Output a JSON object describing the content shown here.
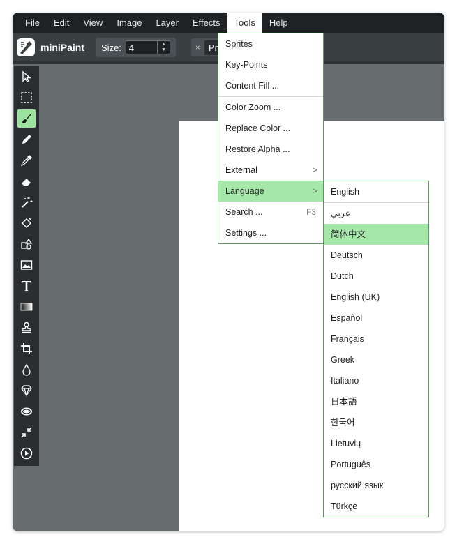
{
  "menubar": {
    "items": [
      "File",
      "Edit",
      "View",
      "Image",
      "Layer",
      "Effects",
      "Tools",
      "Help"
    ],
    "active_index": 6
  },
  "toolbar": {
    "brand": "miniPaint",
    "size_label": "Size:",
    "size_value": "4",
    "preview_close": "×",
    "preview_label": "Pre"
  },
  "tools_sidebar": {
    "icons": [
      "select-arrow-icon",
      "selection-rect-icon",
      "brush-icon",
      "pencil-icon",
      "pipette-icon",
      "eraser-icon",
      "magic-wand-icon",
      "fill-bucket-icon",
      "shapes-icon",
      "image-icon",
      "text-icon",
      "gradient-icon",
      "clone-stamp-icon",
      "crop-icon",
      "blur-icon",
      "sharpen-icon",
      "bulge-icon",
      "pinch-icon",
      "animation-icon"
    ],
    "active_index": 2
  },
  "tools_menu": {
    "items": [
      {
        "label": "Sprites"
      },
      {
        "label": "Key-Points"
      },
      {
        "label": "Content Fill ..."
      },
      {
        "label": "Color Zoom ..."
      },
      {
        "label": "Replace Color ..."
      },
      {
        "label": "Restore Alpha ..."
      },
      {
        "label": "External",
        "submenu": ">"
      },
      {
        "label": "Language",
        "submenu": ">"
      },
      {
        "label": "Search ...",
        "shortcut": "F3"
      },
      {
        "label": "Settings ..."
      }
    ],
    "highlighted_index": 7
  },
  "language_menu": {
    "items": [
      "English",
      "عربي",
      "简体中文",
      "Deutsch",
      "Dutch",
      "English (UK)",
      "Español",
      "Français",
      "Greek",
      "Italiano",
      "日本語",
      "한국어",
      "Lietuvių",
      "Português",
      "русский язык",
      "Türkçe"
    ],
    "highlighted_index": 2
  },
  "colors": {
    "accent_highlight": "#a6e8a9",
    "menubar_bg": "#1f2224",
    "workspace_bg": "#676c6e"
  }
}
